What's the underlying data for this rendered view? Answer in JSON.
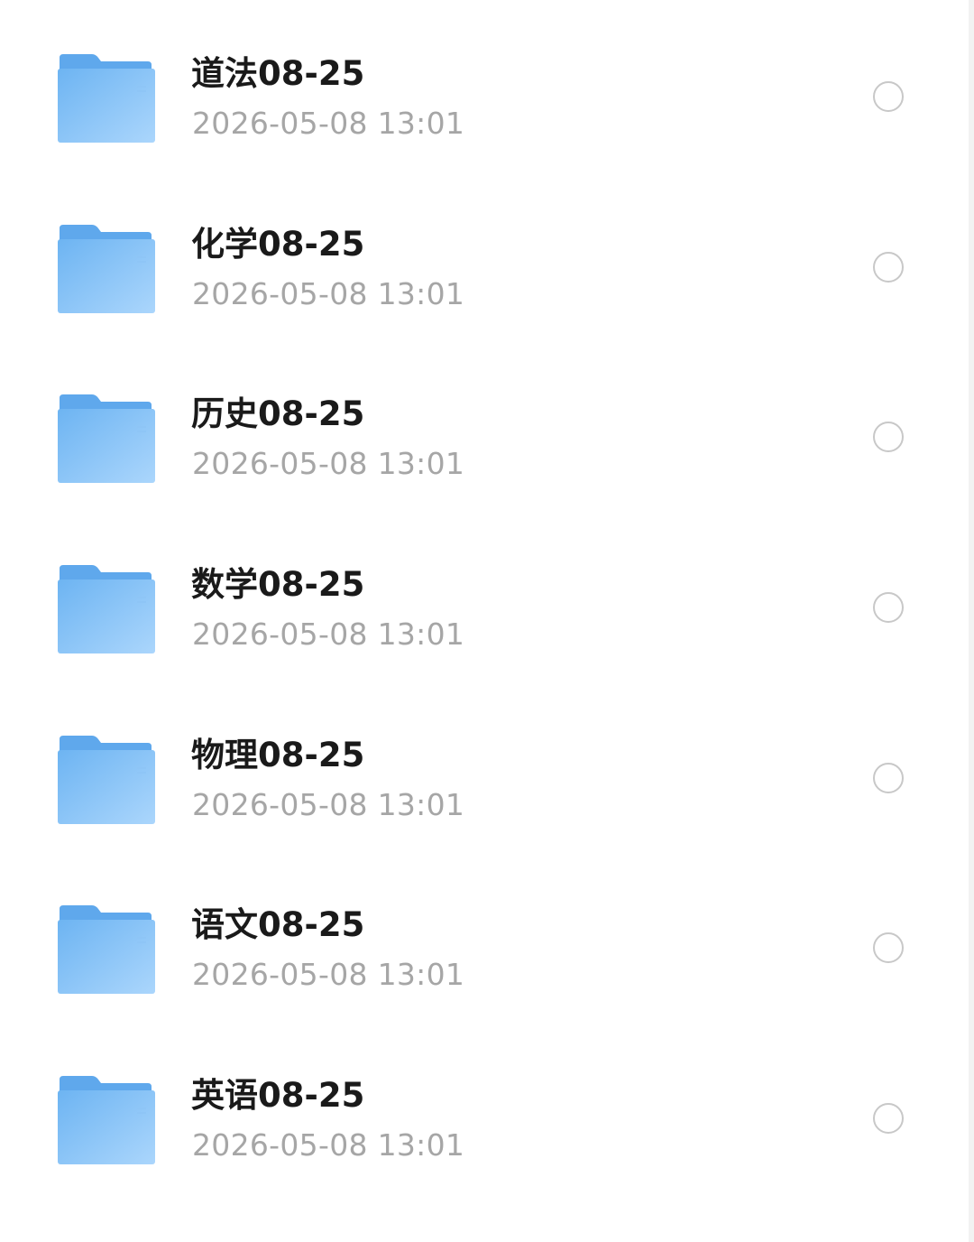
{
  "folders": [
    {
      "name": "道法08-25",
      "date": "2026-05-08 13:01",
      "icon": "folder-icon"
    },
    {
      "name": "化学08-25",
      "date": "2026-05-08 13:01",
      "icon": "folder-icon"
    },
    {
      "name": "历史08-25",
      "date": "2026-05-08 13:01",
      "icon": "folder-icon"
    },
    {
      "name": "数学08-25",
      "date": "2026-05-08 13:01",
      "icon": "folder-icon"
    },
    {
      "name": "物理08-25",
      "date": "2026-05-08 13:01",
      "icon": "folder-icon"
    },
    {
      "name": "语文08-25",
      "date": "2026-05-08 13:01",
      "icon": "folder-icon"
    },
    {
      "name": "英语08-25",
      "date": "2026-05-08 13:01",
      "icon": "folder-icon"
    }
  ],
  "colors": {
    "folder_back": "#5fa8ec",
    "folder_front_light": "#a9d4fb",
    "folder_front_dark": "#6db4f2",
    "name_text": "#1a1a1a",
    "date_text": "#a6a6a6",
    "radio_border": "#c8c8c8"
  }
}
